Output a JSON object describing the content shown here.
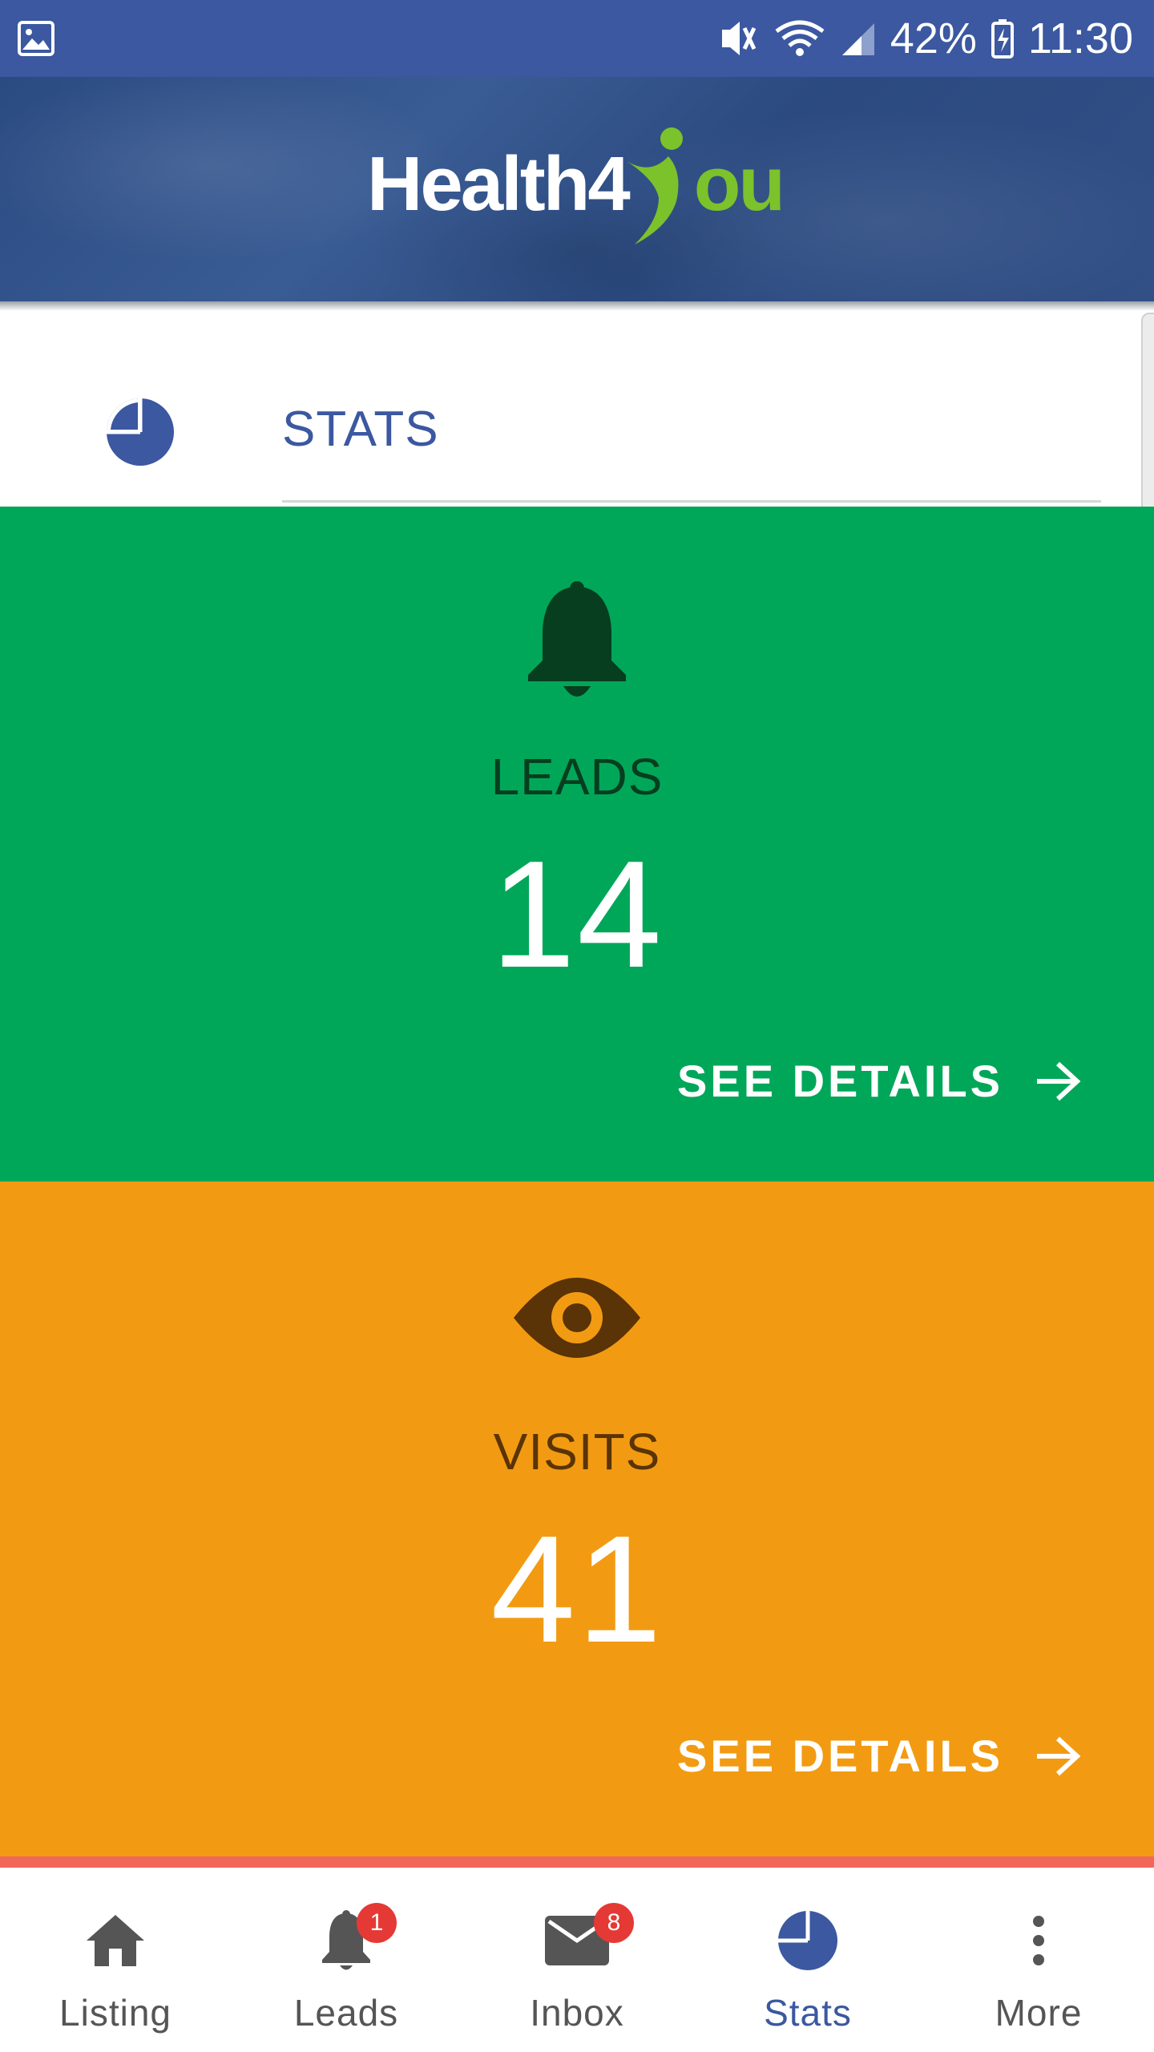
{
  "status_bar": {
    "battery": "42%",
    "time": "11:30"
  },
  "header": {
    "logo_text_white": "Health4",
    "logo_text_green": "ou"
  },
  "stats_section": {
    "title": "STATS",
    "icon": "pie-chart-icon"
  },
  "cards": [
    {
      "label": "LEADS",
      "value": "14",
      "icon": "bell-icon",
      "action": "SEE DETAILS",
      "color": "#01a759"
    },
    {
      "label": "VISITS",
      "value": "41",
      "icon": "eye-icon",
      "action": "SEE DETAILS",
      "color": "#f29b12"
    }
  ],
  "bottom_nav": {
    "items": [
      {
        "label": "Listing",
        "icon": "home-icon"
      },
      {
        "label": "Leads",
        "icon": "bell-icon",
        "badge": "1"
      },
      {
        "label": "Inbox",
        "icon": "mail-icon",
        "badge": "8"
      },
      {
        "label": "Stats",
        "icon": "pie-chart-icon",
        "active": true
      },
      {
        "label": "More",
        "icon": "more-vert-icon"
      }
    ]
  },
  "colors": {
    "primary": "#3b58a0",
    "brand_green": "#7cc22b",
    "badge": "#e53935"
  }
}
